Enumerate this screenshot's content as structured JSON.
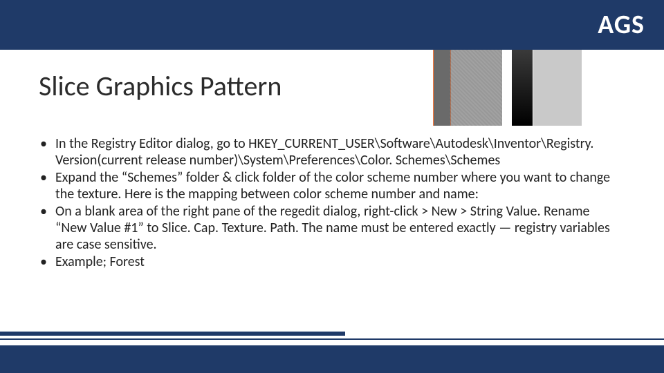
{
  "header": {
    "brand": "AGS"
  },
  "title": "Slice Graphics Pattern",
  "bullets": [
    "In the Registry Editor dialog, go to HKEY_CURRENT_USER\\Software\\Autodesk\\Inventor\\Registry. Version(current release number)\\System\\Preferences\\Color. Schemes\\Schemes",
    "Expand the “Schemes” folder & click folder of the color scheme number where you want to change the texture.  Here is the mapping between color scheme number and name:",
    "On a blank area of the right pane of the regedit dialog, right-click > New > String Value.  Rename “New Value #1” to Slice. Cap. Texture. Path. The name must be entered exactly — registry variables are case sensitive.",
    "Example; Forest"
  ]
}
